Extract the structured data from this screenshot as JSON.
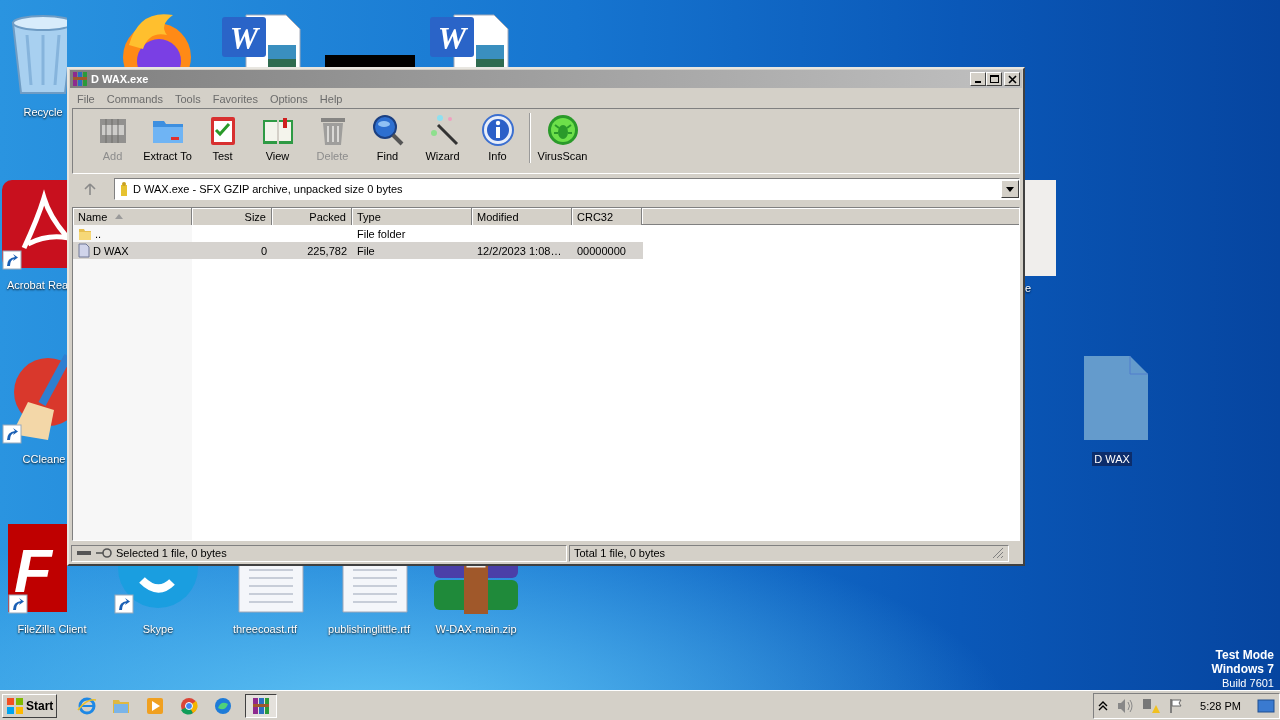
{
  "desktop": {
    "icons": [
      {
        "kind": "recycle-bin",
        "label": "Recycle",
        "selected": false,
        "shortcut": false
      },
      {
        "kind": "browser",
        "selected": false
      },
      {
        "kind": "word-doc",
        "glyph": "W",
        "selected": false
      },
      {
        "kind": "word-doc",
        "glyph": "W",
        "selected": false
      },
      {
        "kind": "pdf-app",
        "label": "Acrobat Rea",
        "selected": false,
        "shortcut": true
      },
      {
        "kind": "partial-tile",
        "label": "e",
        "selected": false
      },
      {
        "kind": "broom-app",
        "label": "CCleane",
        "selected": false,
        "shortcut": true
      },
      {
        "kind": "blank-file",
        "label": "D WAX",
        "selected": true,
        "shortcut": false
      },
      {
        "kind": "fz-app",
        "glyph": "F",
        "label": "FileZilla Client",
        "selected": false,
        "shortcut": true
      },
      {
        "kind": "chat-app",
        "label": "Skype",
        "selected": false,
        "shortcut": true
      },
      {
        "kind": "rtf-doc",
        "label": "threecoast.rtf",
        "selected": false,
        "shortcut": false
      },
      {
        "kind": "rtf-doc",
        "label": "publishinglittle.rtf",
        "selected": false,
        "shortcut": false
      },
      {
        "kind": "archive",
        "label": "W-DAX-main.zip",
        "selected": false,
        "shortcut": false
      }
    ],
    "redaction_bar": true,
    "system_text": [
      "Test Mode",
      "Windows 7",
      "Build 7601"
    ]
  },
  "window": {
    "title": "D WAX.exe",
    "menu": [
      "File",
      "Commands",
      "Tools",
      "Favorites",
      "Options",
      "Help"
    ],
    "toolbar": [
      {
        "kind": "add",
        "label": "Add",
        "disabled": true
      },
      {
        "kind": "extract",
        "label": "Extract To",
        "disabled": false
      },
      {
        "kind": "test",
        "label": "Test",
        "disabled": false
      },
      {
        "kind": "view",
        "label": "View",
        "disabled": false
      },
      {
        "kind": "delete",
        "label": "Delete",
        "disabled": true
      },
      {
        "kind": "find",
        "label": "Find",
        "disabled": false
      },
      {
        "kind": "wizard",
        "label": "Wizard",
        "disabled": false
      },
      {
        "kind": "info",
        "label": "Info",
        "disabled": false
      },
      {
        "kind": "virus",
        "label": "VirusScan",
        "disabled": false
      }
    ],
    "address": "D WAX.exe - SFX GZIP archive, unpacked size 0 bytes",
    "columns": [
      {
        "label": "Name",
        "sorted": true
      },
      {
        "label": "Size",
        "sorted": false
      },
      {
        "label": "Packed",
        "sorted": false
      },
      {
        "label": "Type",
        "sorted": false
      },
      {
        "label": "Modified",
        "sorted": false
      },
      {
        "label": "CRC32",
        "sorted": false
      }
    ],
    "rows": [
      {
        "kind": "folder",
        "selected": false,
        "name": "..",
        "type": "File folder"
      },
      {
        "kind": "file",
        "selected": true,
        "name": "D WAX",
        "size": "0",
        "packed": "225,782",
        "type": "File",
        "modified": "12/2/2023 1:08…",
        "crc32": "00000000"
      }
    ],
    "status": [
      "Selected 1 file, 0 bytes",
      "Total 1 file, 0 bytes"
    ]
  },
  "taskbar": {
    "start": "Start",
    "apps": [
      {
        "kind": "ie",
        "active": false
      },
      {
        "kind": "folder",
        "active": false
      },
      {
        "kind": "media",
        "active": false
      },
      {
        "kind": "chrome",
        "active": false
      },
      {
        "kind": "edge",
        "active": false
      },
      {
        "kind": "winrar",
        "active": true
      }
    ],
    "clock": "5:28 PM"
  }
}
